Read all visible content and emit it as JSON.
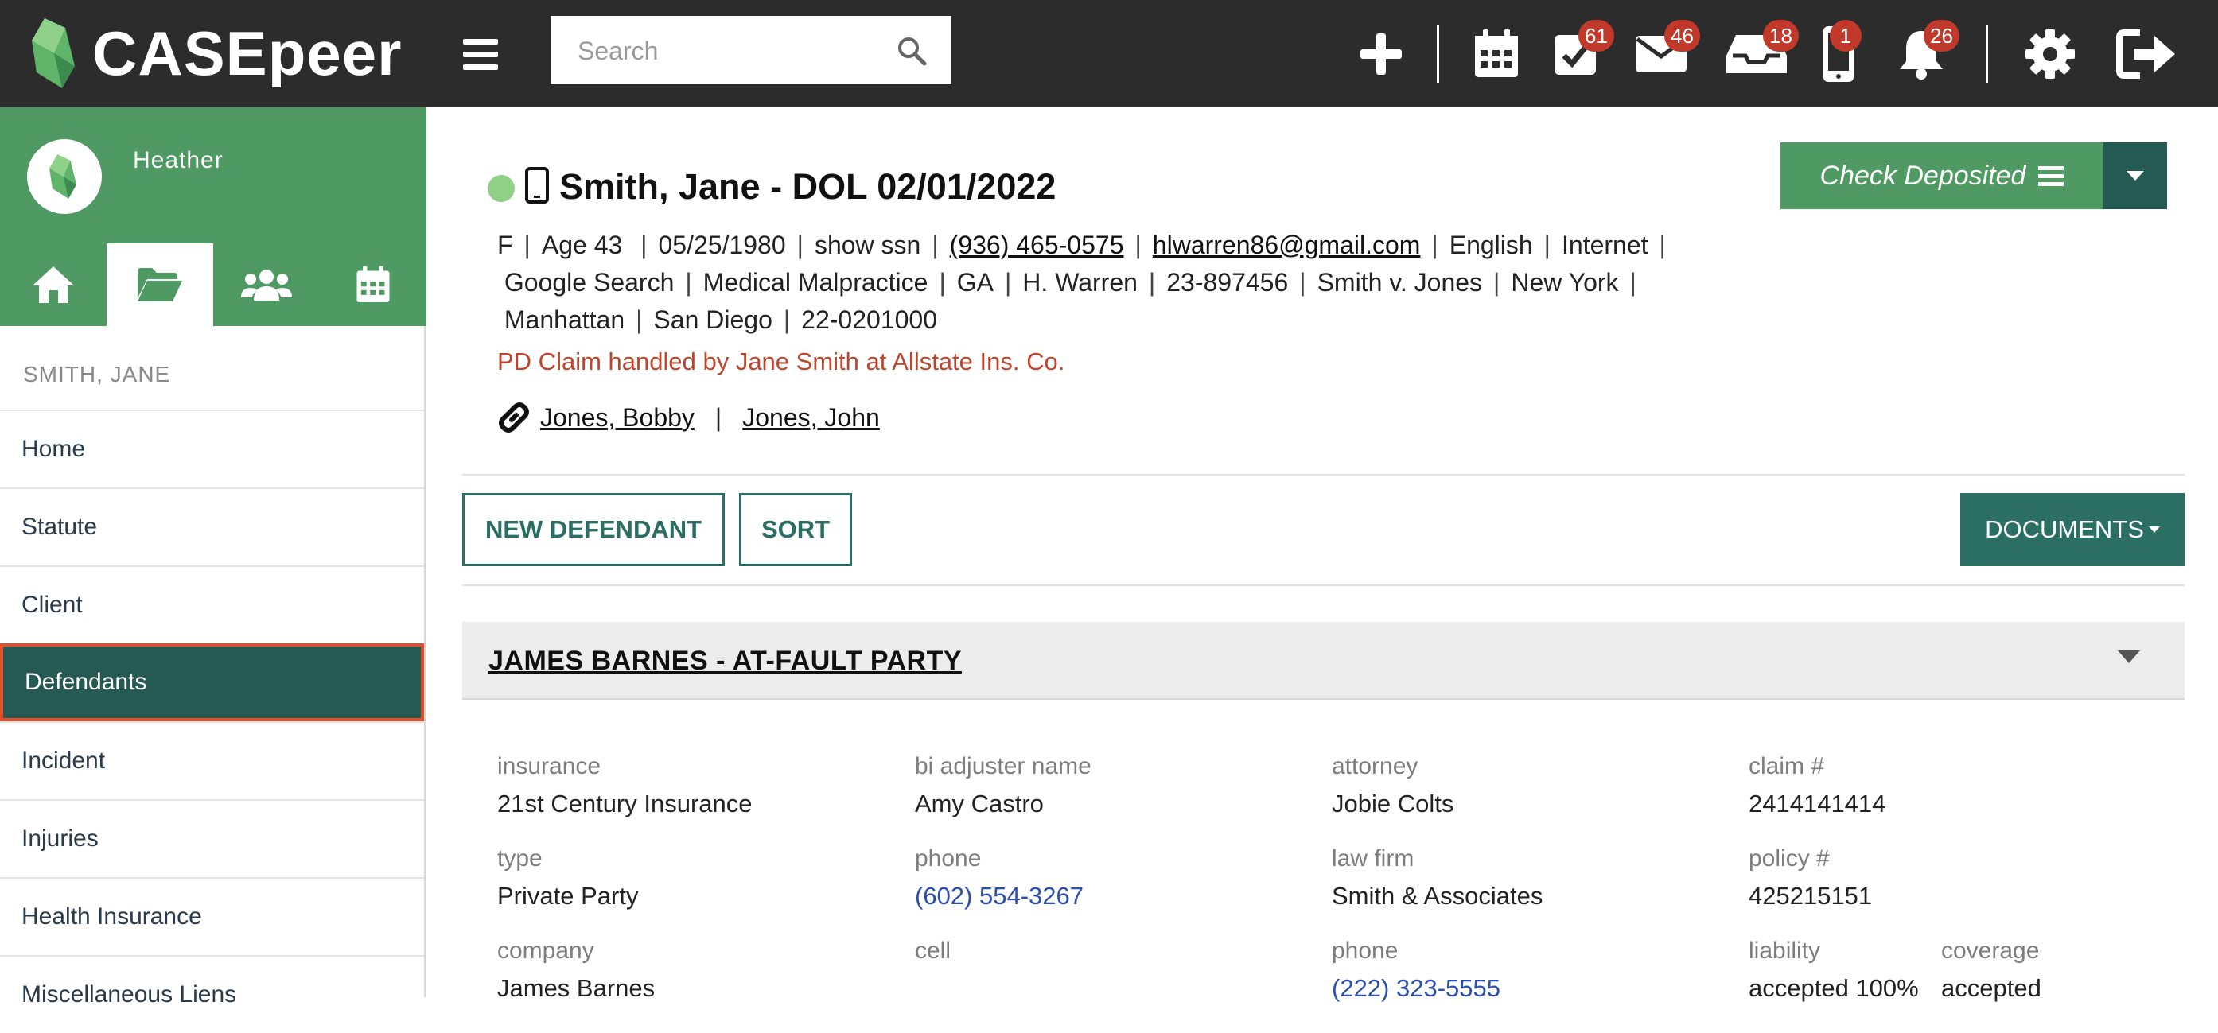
{
  "topbar": {
    "logo_text": "CASEpeer",
    "search_placeholder": "Search",
    "badges": {
      "tasks": "61",
      "mail": "46",
      "inbox": "18",
      "phone": "1",
      "notifications": "26"
    }
  },
  "sidebar": {
    "user_name": "Heather",
    "case_label": "SMITH, JANE",
    "items": [
      "Home",
      "Statute",
      "Client",
      "Defendants",
      "Incident",
      "Injuries",
      "Health Insurance",
      "Miscellaneous Liens"
    ]
  },
  "case": {
    "title": "Smith, Jane - DOL 02/01/2022",
    "meta": {
      "sex": "F",
      "age": "Age 43",
      "dob": "05/25/1980",
      "ssn": "show ssn",
      "phone": "(936) 465-0575",
      "email": "hlwarren86@gmail.com",
      "language": "English",
      "source": "Internet",
      "referral": "Google Search",
      "case_type": "Medical Malpractice",
      "state": "GA",
      "attorney": "H. Warren",
      "case_no": "23-897456",
      "caption": "Smith v. Jones",
      "city": "New York",
      "borough": "Manhattan",
      "office": "San Diego",
      "code": "22-0201000"
    },
    "pd_claim": "PD Claim handled by Jane Smith at Allstate Ins. Co.",
    "related": [
      "Jones, Bobby",
      "Jones, John"
    ],
    "check_deposited_label": "Check Deposited"
  },
  "actions": {
    "new_defendant": "NEW DEFENDANT",
    "sort": "SORT",
    "documents": "DOCUMENTS"
  },
  "defendant": {
    "title": "JAMES BARNES - AT-FAULT PARTY",
    "insurance_label": "insurance",
    "insurance": "21st Century Insurance",
    "bi_adjuster_label": "bi adjuster name",
    "bi_adjuster": "Amy Castro",
    "attorney_label": "attorney",
    "attorney": "Jobie Colts",
    "claim_label": "claim #",
    "claim": "2414141414",
    "type_label": "type",
    "type": "Private Party",
    "phone_label": "phone",
    "phone": "(602) 554-3267",
    "law_firm_label": "law firm",
    "law_firm": "Smith & Associates",
    "policy_label": "policy #",
    "policy": "425215151",
    "company_label": "company",
    "company": "James Barnes",
    "cell_label": "cell",
    "attorney_phone_label": "phone",
    "attorney_phone": "(222) 323-5555",
    "liability_label": "liability",
    "liability": "accepted 100%",
    "coverage_label": "coverage",
    "coverage": "accepted"
  },
  "colors": {
    "brand_green": "#4e9a62",
    "dark_teal": "#245a52",
    "accent_red": "#c0392b",
    "topbar": "#2c2c2c"
  }
}
